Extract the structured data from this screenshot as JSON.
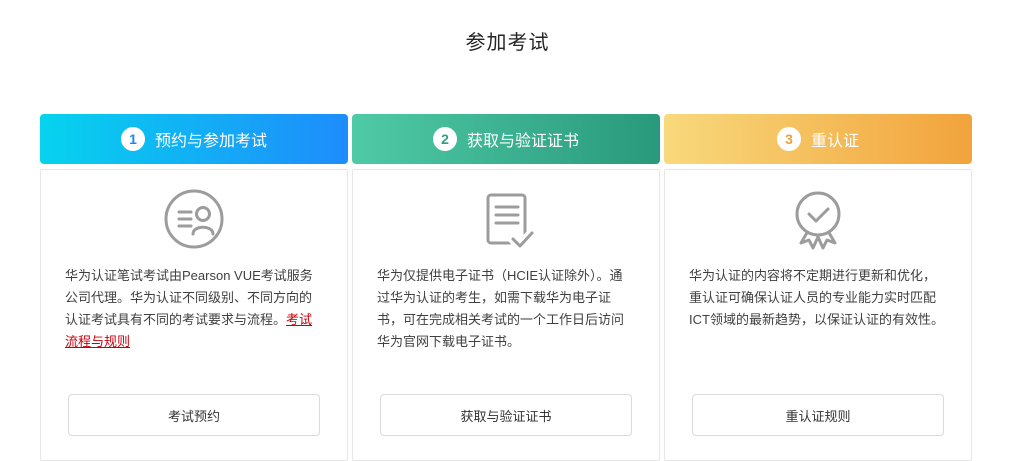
{
  "page": {
    "title": "参加考试"
  },
  "colors": {
    "step1_gradient_from": "#06d3ee",
    "step1_gradient_to": "#1e8cfc",
    "step2_gradient_from": "#4fcaa6",
    "step2_gradient_to": "#29997c",
    "step3_gradient_from": "#f8d97c",
    "step3_gradient_to": "#f2a33c",
    "link_red": "#c7000b",
    "icon_gray": "#9c9c9c",
    "body_text": "#404040",
    "card_border": "#e6e6e6"
  },
  "steps": [
    {
      "number": "1",
      "title": "预约与参加考试",
      "icon": "id-card-person-icon",
      "text": "华为认证笔试考试由Pearson VUE考试服务公司代理。华为认证不同级别、不同方向的认证考试具有不同的考试要求与流程。",
      "link_label": "考试流程与规则",
      "button_label": "考试预约"
    },
    {
      "number": "2",
      "title": "获取与验证证书",
      "icon": "document-check-icon",
      "text": "华为仅提供电子证书（HCIE认证除外）。通过华为认证的考生，如需下载华为电子证书，可在完成相关考试的一个工作日后访问华为官网下载电子证书。",
      "button_label": "获取与验证证书"
    },
    {
      "number": "3",
      "title": "重认证",
      "icon": "medal-check-icon",
      "text": "华为认证的内容将不定期进行更新和优化，重认证可确保认证人员的专业能力实时匹配ICT领域的最新趋势，以保证认证的有效性。",
      "button_label": "重认证规则"
    }
  ]
}
